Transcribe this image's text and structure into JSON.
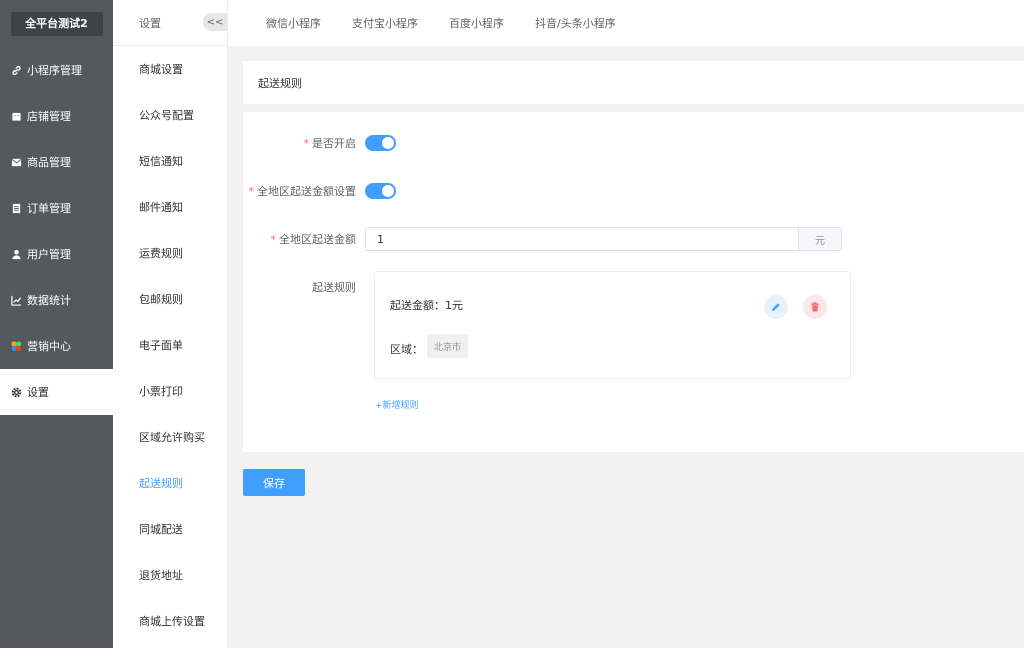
{
  "brand": "全平台测试2",
  "sidebar": {
    "items": [
      {
        "label": "小程序管理",
        "icon": "link-icon"
      },
      {
        "label": "店铺管理",
        "icon": "store-icon"
      },
      {
        "label": "商品管理",
        "icon": "mail-icon"
      },
      {
        "label": "订单管理",
        "icon": "clipboard-icon"
      },
      {
        "label": "用户管理",
        "icon": "user-icon"
      },
      {
        "label": "数据统计",
        "icon": "chart-icon"
      },
      {
        "label": "营销中心",
        "icon": "palette-icon"
      },
      {
        "label": "设置",
        "icon": "gear-icon",
        "active": true
      }
    ]
  },
  "submenu": {
    "title": "设置",
    "collapse": "<<",
    "items": [
      "商城设置",
      "公众号配置",
      "短信通知",
      "邮件通知",
      "运费规则",
      "包邮规则",
      "电子面单",
      "小票打印",
      "区域允许购买",
      "起送规则",
      "同城配送",
      "退货地址",
      "商城上传设置"
    ],
    "active_index": 9
  },
  "tabs": [
    "微信小程序",
    "支付宝小程序",
    "百度小程序",
    "抖音/头条小程序"
  ],
  "page_title": "起送规则",
  "form": {
    "enable_label": "是否开启",
    "all_region_label": "全地区起送金额设置",
    "amount_label": "全地区起送金额",
    "amount_value": "1",
    "amount_unit": "元",
    "rules_label": "起送规则",
    "rule": {
      "amount_text": "起送金额：1元",
      "area_label": "区域：",
      "area_tag": "北京市"
    },
    "add_rule": "+新增规则"
  },
  "save_label": "保存",
  "colors": {
    "primary": "#409eff",
    "danger": "#f56c6c",
    "sidebar": "#55595f"
  }
}
